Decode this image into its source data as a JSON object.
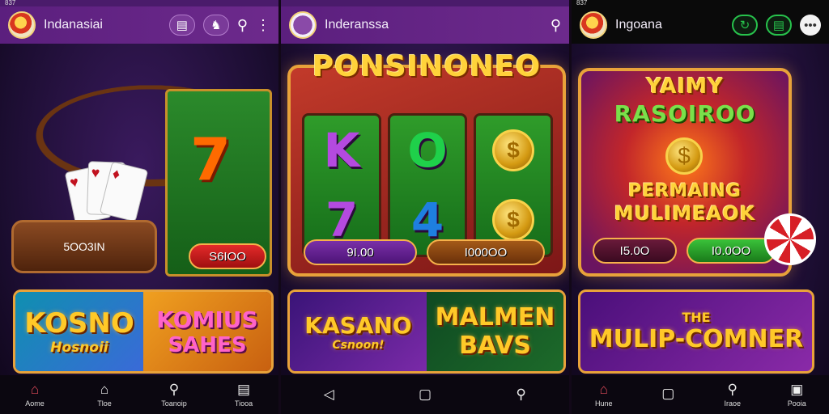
{
  "screen1": {
    "status": "837",
    "app_title": "Indanasiai",
    "roulette_tray_label": "5OO3IN",
    "prize_button": "S6IOO",
    "banner_left": [
      "KOSNO",
      "Hosnoii"
    ],
    "banner_right": [
      "KOMIUS",
      "SAHES"
    ],
    "nav": [
      "Aome",
      "Tloe",
      "Toanoip",
      "Tiooa"
    ]
  },
  "screen2": {
    "app_title": "Inderanssa",
    "headline": "PONSINONEO",
    "reel_symbols": [
      "K",
      "O",
      "7",
      "4"
    ],
    "bet_left": "9I.00",
    "bet_right": "I000OO",
    "banner_left": [
      "KASANO",
      "Csnoon!"
    ],
    "banner_right": [
      "MALMEN",
      "BAVS"
    ]
  },
  "screen3": {
    "status": "837",
    "app_title": "Ingoana",
    "headline_top": [
      "YAIMY",
      "RASOIROO"
    ],
    "headline_bottom": [
      "PERMAING",
      "MULIMEAOK"
    ],
    "bet_left": "I5.0O",
    "bet_right": "I0.0OO",
    "banner": [
      "THE",
      "MULIP-COMNER"
    ],
    "nav": [
      "Hune",
      "",
      "Iraoe",
      "Pooia"
    ]
  },
  "colors": {
    "topbar_purple": "#5b1f7e",
    "gold": "#ffc928",
    "frame_orange": "#e8a23a",
    "reel_green": "#2f9c2a",
    "active_red": "#e04a5a"
  }
}
